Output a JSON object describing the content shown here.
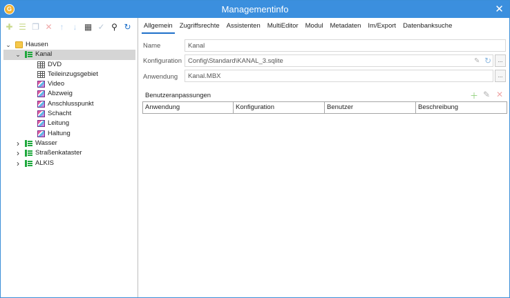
{
  "window": {
    "title": "Managementinfo",
    "app_icon_letter": "G"
  },
  "toolbar": {
    "buttons": [
      {
        "name": "new-icon",
        "glyph": "✚",
        "color": "#c8d88a"
      },
      {
        "name": "add-child-icon",
        "glyph": "☰",
        "color": "#c8d88a"
      },
      {
        "name": "copy-icon",
        "glyph": "❐",
        "color": "#b8c6d6"
      },
      {
        "name": "delete-icon",
        "glyph": "✕",
        "color": "#f0a8a8"
      },
      {
        "name": "move-up-icon",
        "glyph": "↑",
        "color": "#b8d4f0"
      },
      {
        "name": "move-down-icon",
        "glyph": "↓",
        "color": "#b8d4f0"
      },
      {
        "name": "properties-icon",
        "glyph": "▦",
        "color": "#444444"
      },
      {
        "name": "check-icon",
        "glyph": "✓",
        "color": "#b8c6d6"
      },
      {
        "name": "search-icon",
        "glyph": "⚲",
        "color": "#222222"
      },
      {
        "name": "refresh-icon",
        "glyph": "↻",
        "color": "#1c6fc9"
      }
    ]
  },
  "tree": [
    {
      "label": "Hausen",
      "level": 0,
      "icon": "folder",
      "expanded": true,
      "selected": false
    },
    {
      "label": "Kanal",
      "level": 1,
      "icon": "layer",
      "expanded": true,
      "selected": true
    },
    {
      "label": "DVD",
      "level": 2,
      "icon": "table"
    },
    {
      "label": "Teileinzugsgebiet",
      "level": 2,
      "icon": "table"
    },
    {
      "label": "Video",
      "level": 2,
      "icon": "feature"
    },
    {
      "label": "Abzweig",
      "level": 2,
      "icon": "feature"
    },
    {
      "label": "Anschlusspunkt",
      "level": 2,
      "icon": "feature"
    },
    {
      "label": "Schacht",
      "level": 2,
      "icon": "feature"
    },
    {
      "label": "Leitung",
      "level": 2,
      "icon": "feature"
    },
    {
      "label": "Haltung",
      "level": 2,
      "icon": "feature"
    },
    {
      "label": "Wasser",
      "level": 1,
      "icon": "layer",
      "expanded": false
    },
    {
      "label": "Straßenkataster",
      "level": 1,
      "icon": "layer",
      "expanded": false
    },
    {
      "label": "ALKIS",
      "level": 1,
      "icon": "layer",
      "expanded": false
    }
  ],
  "tabs": [
    {
      "label": "Allgemein",
      "active": true
    },
    {
      "label": "Zugriffsrechte"
    },
    {
      "label": "Assistenten"
    },
    {
      "label": "MultiEditor"
    },
    {
      "label": "Modul"
    },
    {
      "label": "Metadaten"
    },
    {
      "label": "Im/Export"
    },
    {
      "label": "Datenbanksuche"
    }
  ],
  "form": {
    "name_label": "Name",
    "name_value": "Kanal",
    "config_label": "Konfiguration",
    "config_value": "Config\\Standard\\KANAL_3.sqlite",
    "app_label": "Anwendung",
    "app_value": "Kanal.MBX",
    "browse_label": "..."
  },
  "customizations": {
    "label": "Benutzeranpassungen",
    "columns": [
      "Anwendung",
      "Konfiguration",
      "Benutzer",
      "Beschreibung"
    ],
    "rows": []
  }
}
